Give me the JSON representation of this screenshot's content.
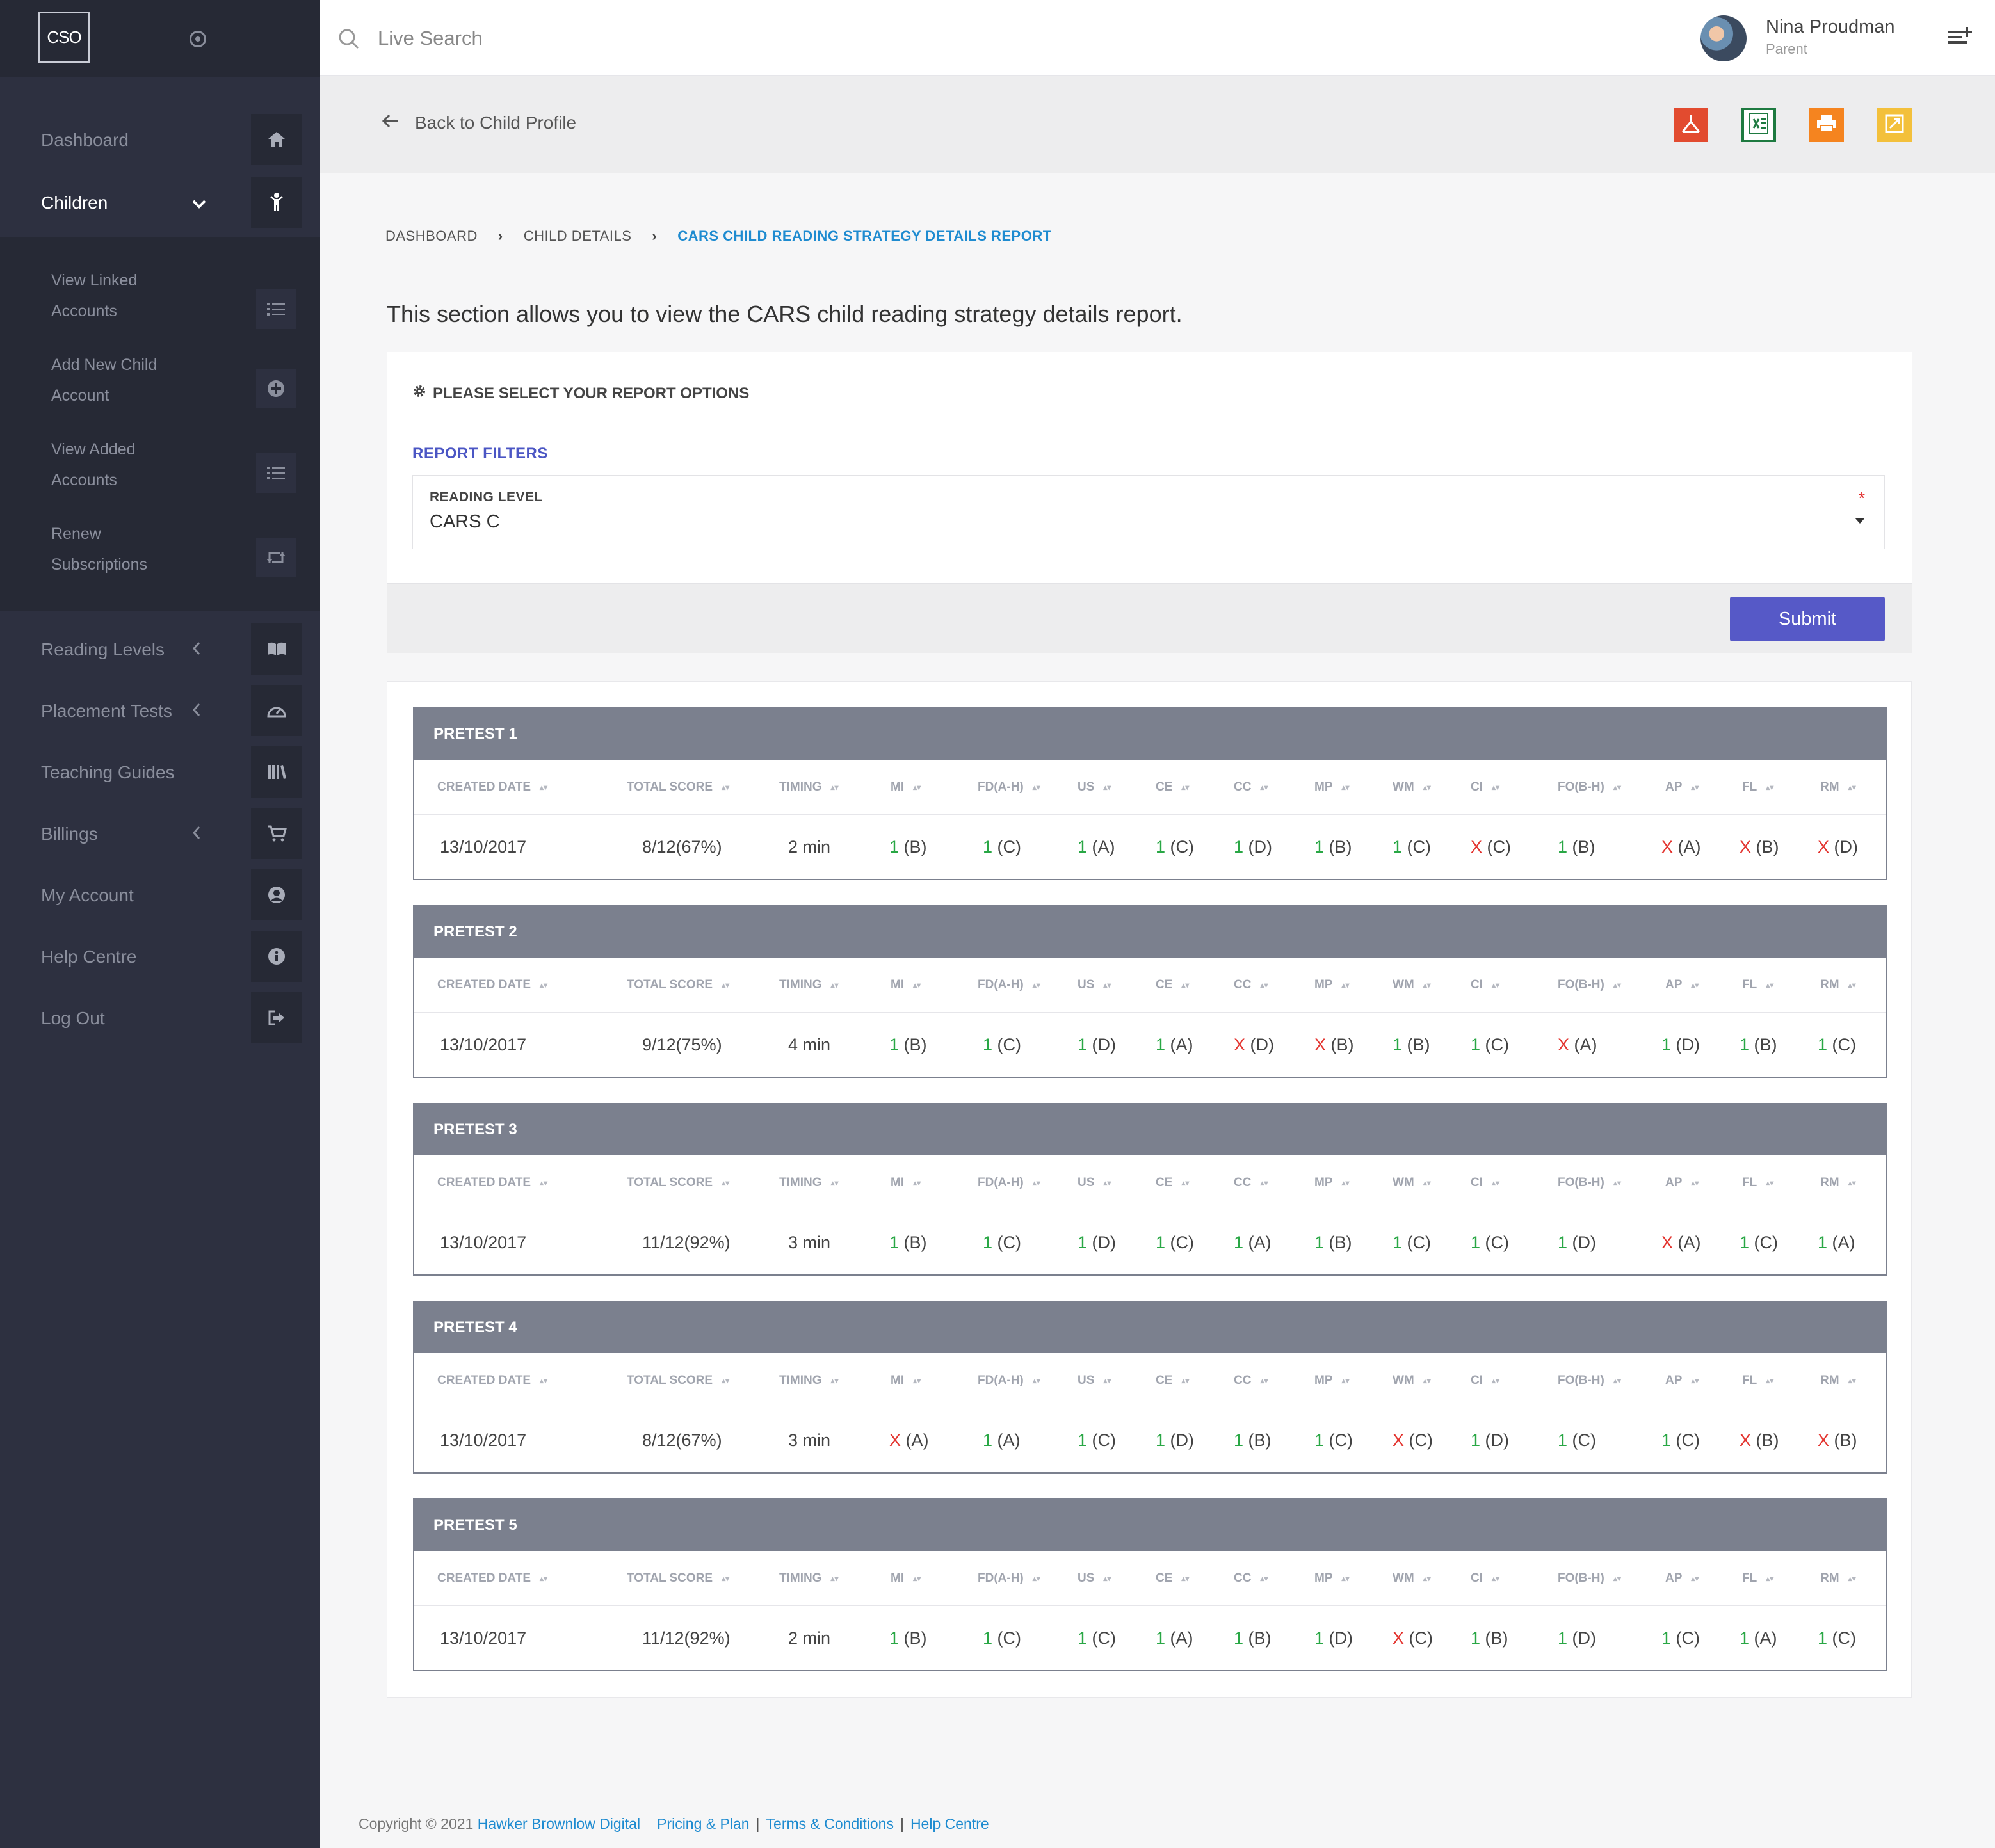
{
  "app": {
    "logo_text": "CSO"
  },
  "search": {
    "placeholder": "Live Search"
  },
  "user": {
    "name": "Nina Proudman",
    "role": "Parent"
  },
  "sidebar": {
    "items": [
      {
        "label": "Dashboard",
        "icon": "home-icon"
      },
      {
        "label": "Children",
        "icon": "child-icon",
        "active": true
      },
      {
        "label": "Reading Levels",
        "icon": "book-icon"
      },
      {
        "label": "Placement Tests",
        "icon": "gauge-icon"
      },
      {
        "label": "Teaching Guides",
        "icon": "library-icon"
      },
      {
        "label": "Billings",
        "icon": "cart-icon"
      },
      {
        "label": "My Account",
        "icon": "user-circle-icon"
      },
      {
        "label": "Help Centre",
        "icon": "info-icon"
      },
      {
        "label": "Log Out",
        "icon": "logout-icon"
      }
    ],
    "children_submenu": [
      {
        "label": "View Linked Accounts",
        "icon": "list-icon"
      },
      {
        "label": "Add New Child Account",
        "icon": "plus-circle-icon"
      },
      {
        "label": "View Added Accounts",
        "icon": "list-icon"
      },
      {
        "label": "Renew Subscriptions",
        "icon": "retweet-icon"
      }
    ]
  },
  "pagebar": {
    "back_label": "Back to Child Profile",
    "exports": [
      "pdf-icon",
      "excel-icon",
      "print-icon",
      "link-icon"
    ],
    "export_colors": {
      "pdf": "#e24b2f",
      "excel": "#1e7a40",
      "print": "#f5841f",
      "link": "#f3c03b"
    }
  },
  "breadcrumb": [
    "DASHBOARD",
    "CHILD DETAILS",
    "CARS CHILD READING STRATEGY DETAILS REPORT"
  ],
  "intro": "This section allows you to view the CARS child reading strategy details report.",
  "options": {
    "title": "PLEASE SELECT YOUR REPORT OPTIONS",
    "filters_title": "REPORT FILTERS",
    "reading_level_label": "READING LEVEL",
    "reading_level_value": "CARS C",
    "required_mark": "*",
    "submit_label": "Submit"
  },
  "columns": [
    "CREATED DATE",
    "TOTAL SCORE",
    "TIMING",
    "MI",
    "FD(A-H)",
    "US",
    "CE",
    "CC",
    "MP",
    "WM",
    "CI",
    "FO(B-H)",
    "AP",
    "FL",
    "RM"
  ],
  "pretests": [
    {
      "title": "PRETEST 1",
      "date": "13/10/2017",
      "score": "8/12(67%)",
      "timing": "2 min",
      "results": [
        [
          "1",
          "(B)"
        ],
        [
          "1",
          "(C)"
        ],
        [
          "1",
          "(A)"
        ],
        [
          "1",
          "(C)"
        ],
        [
          "1",
          "(D)"
        ],
        [
          "1",
          "(B)"
        ],
        [
          "1",
          "(C)"
        ],
        [
          "X",
          "(C)"
        ],
        [
          "1",
          "(B)"
        ],
        [
          "X",
          "(A)"
        ],
        [
          "X",
          "(B)"
        ],
        [
          "X",
          "(D)"
        ]
      ]
    },
    {
      "title": "PRETEST 2",
      "date": "13/10/2017",
      "score": "9/12(75%)",
      "timing": "4 min",
      "results": [
        [
          "1",
          "(B)"
        ],
        [
          "1",
          "(C)"
        ],
        [
          "1",
          "(D)"
        ],
        [
          "1",
          "(A)"
        ],
        [
          "X",
          "(D)"
        ],
        [
          "X",
          "(B)"
        ],
        [
          "1",
          "(B)"
        ],
        [
          "1",
          "(C)"
        ],
        [
          "X",
          "(A)"
        ],
        [
          "1",
          "(D)"
        ],
        [
          "1",
          "(B)"
        ],
        [
          "1",
          "(C)"
        ]
      ]
    },
    {
      "title": "PRETEST 3",
      "date": "13/10/2017",
      "score": "11/12(92%)",
      "timing": "3 min",
      "results": [
        [
          "1",
          "(B)"
        ],
        [
          "1",
          "(C)"
        ],
        [
          "1",
          "(D)"
        ],
        [
          "1",
          "(C)"
        ],
        [
          "1",
          "(A)"
        ],
        [
          "1",
          "(B)"
        ],
        [
          "1",
          "(C)"
        ],
        [
          "1",
          "(C)"
        ],
        [
          "1",
          "(D)"
        ],
        [
          "X",
          "(A)"
        ],
        [
          "1",
          "(C)"
        ],
        [
          "1",
          "(A)"
        ]
      ]
    },
    {
      "title": "PRETEST 4",
      "date": "13/10/2017",
      "score": "8/12(67%)",
      "timing": "3 min",
      "results": [
        [
          "X",
          "(A)"
        ],
        [
          "1",
          "(A)"
        ],
        [
          "1",
          "(C)"
        ],
        [
          "1",
          "(D)"
        ],
        [
          "1",
          "(B)"
        ],
        [
          "1",
          "(C)"
        ],
        [
          "X",
          "(C)"
        ],
        [
          "1",
          "(D)"
        ],
        [
          "1",
          "(C)"
        ],
        [
          "1",
          "(C)"
        ],
        [
          "X",
          "(B)"
        ],
        [
          "X",
          "(B)"
        ]
      ]
    },
    {
      "title": "PRETEST 5",
      "date": "13/10/2017",
      "score": "11/12(92%)",
      "timing": "2 min",
      "results": [
        [
          "1",
          "(B)"
        ],
        [
          "1",
          "(C)"
        ],
        [
          "1",
          "(C)"
        ],
        [
          "1",
          "(A)"
        ],
        [
          "1",
          "(B)"
        ],
        [
          "1",
          "(D)"
        ],
        [
          "X",
          "(C)"
        ],
        [
          "1",
          "(B)"
        ],
        [
          "1",
          "(D)"
        ],
        [
          "1",
          "(C)"
        ],
        [
          "1",
          "(A)"
        ],
        [
          "1",
          "(C)"
        ]
      ]
    }
  ],
  "footer": {
    "copyright": "Copyright © 2021",
    "company": "Hawker Brownlow Digital",
    "links": [
      "Pricing & Plan",
      "Terms & Conditions",
      "Help Centre"
    ],
    "separator": "|"
  }
}
